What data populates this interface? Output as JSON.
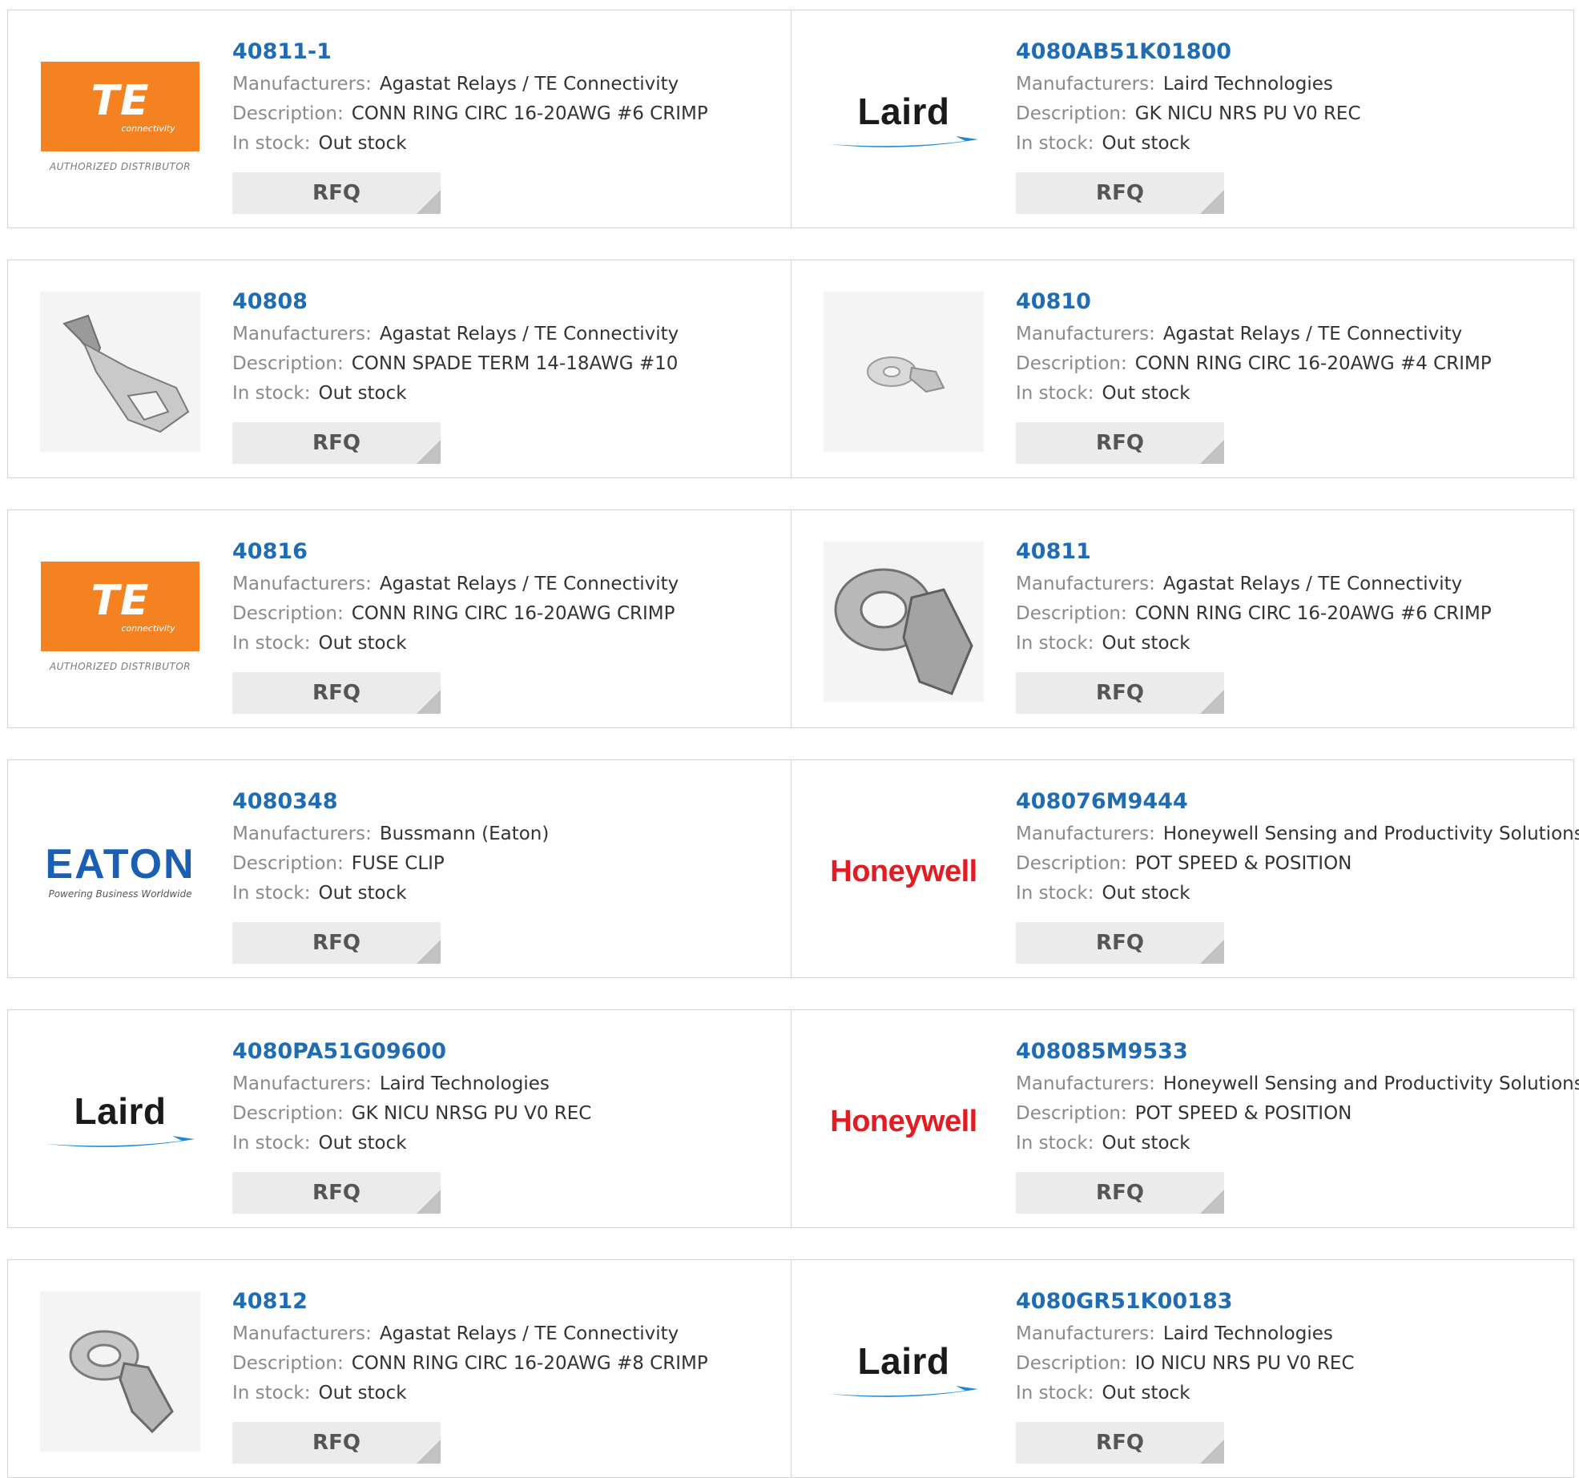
{
  "labels": {
    "manufacturers": "Manufacturers:",
    "description": "Description:",
    "in_stock": "In stock:",
    "rfq": "RFQ"
  },
  "brand_text": {
    "te_mark": "TE",
    "te_connectivity": "connectivity",
    "te_authorized": "AUTHORIZED DISTRIBUTOR",
    "laird": "Laird",
    "eaton": "EATON",
    "eaton_tagline": "Powering Business Worldwide",
    "honeywell": "Honeywell"
  },
  "colors": {
    "part_link": "#1f6cb4",
    "te_orange": "#f58220",
    "laird_swoosh": "#1e88d6",
    "eaton_blue": "#1a5fb4",
    "honeywell_red": "#e31b23",
    "rfq_bg": "#ebebeb",
    "border": "#d4d4d4"
  },
  "products": [
    {
      "part": "40811-1",
      "manufacturer": "Agastat Relays / TE Connectivity",
      "description": "CONN RING CIRC 16-20AWG #6 CRIMP",
      "stock": "Out stock",
      "image": "te-logo"
    },
    {
      "part": "4080AB51K01800",
      "manufacturer": "Laird Technologies",
      "description": "GK NICU NRS PU V0 REC",
      "stock": "Out stock",
      "image": "laird-logo"
    },
    {
      "part": "40808",
      "manufacturer": "Agastat Relays / TE Connectivity",
      "description": "CONN SPADE TERM 14-18AWG #10",
      "stock": "Out stock",
      "image": "spade-terminal-photo"
    },
    {
      "part": "40810",
      "manufacturer": "Agastat Relays / TE Connectivity",
      "description": "CONN RING CIRC 16-20AWG #4 CRIMP",
      "stock": "Out stock",
      "image": "small-ring-terminal-photo"
    },
    {
      "part": "40816",
      "manufacturer": "Agastat Relays / TE Connectivity",
      "description": "CONN RING CIRC 16-20AWG CRIMP",
      "stock": "Out stock",
      "image": "te-logo"
    },
    {
      "part": "40811",
      "manufacturer": "Agastat Relays / TE Connectivity",
      "description": "CONN RING CIRC 16-20AWG #6 CRIMP",
      "stock": "Out stock",
      "image": "large-ring-terminal-photo"
    },
    {
      "part": "4080348",
      "manufacturer": "Bussmann (Eaton)",
      "description": "FUSE CLIP",
      "stock": "Out stock",
      "image": "eaton-logo"
    },
    {
      "part": "408076M9444",
      "manufacturer": "Honeywell Sensing and Productivity Solutions",
      "description": "POT SPEED & POSITION",
      "stock": "Out stock",
      "image": "honeywell-logo"
    },
    {
      "part": "4080PA51G09600",
      "manufacturer": "Laird Technologies",
      "description": "GK NICU NRSG PU V0 REC",
      "stock": "Out stock",
      "image": "laird-logo"
    },
    {
      "part": "408085M9533",
      "manufacturer": "Honeywell Sensing and Productivity Solutions",
      "description": "POT SPEED & POSITION",
      "stock": "Out stock",
      "image": "honeywell-logo"
    },
    {
      "part": "40812",
      "manufacturer": "Agastat Relays / TE Connectivity",
      "description": "CONN RING CIRC 16-20AWG #8 CRIMP",
      "stock": "Out stock",
      "image": "ring-terminal-photo"
    },
    {
      "part": "4080GR51K00183",
      "manufacturer": "Laird Technologies",
      "description": "IO NICU NRS PU V0 REC",
      "stock": "Out stock",
      "image": "laird-logo"
    }
  ]
}
